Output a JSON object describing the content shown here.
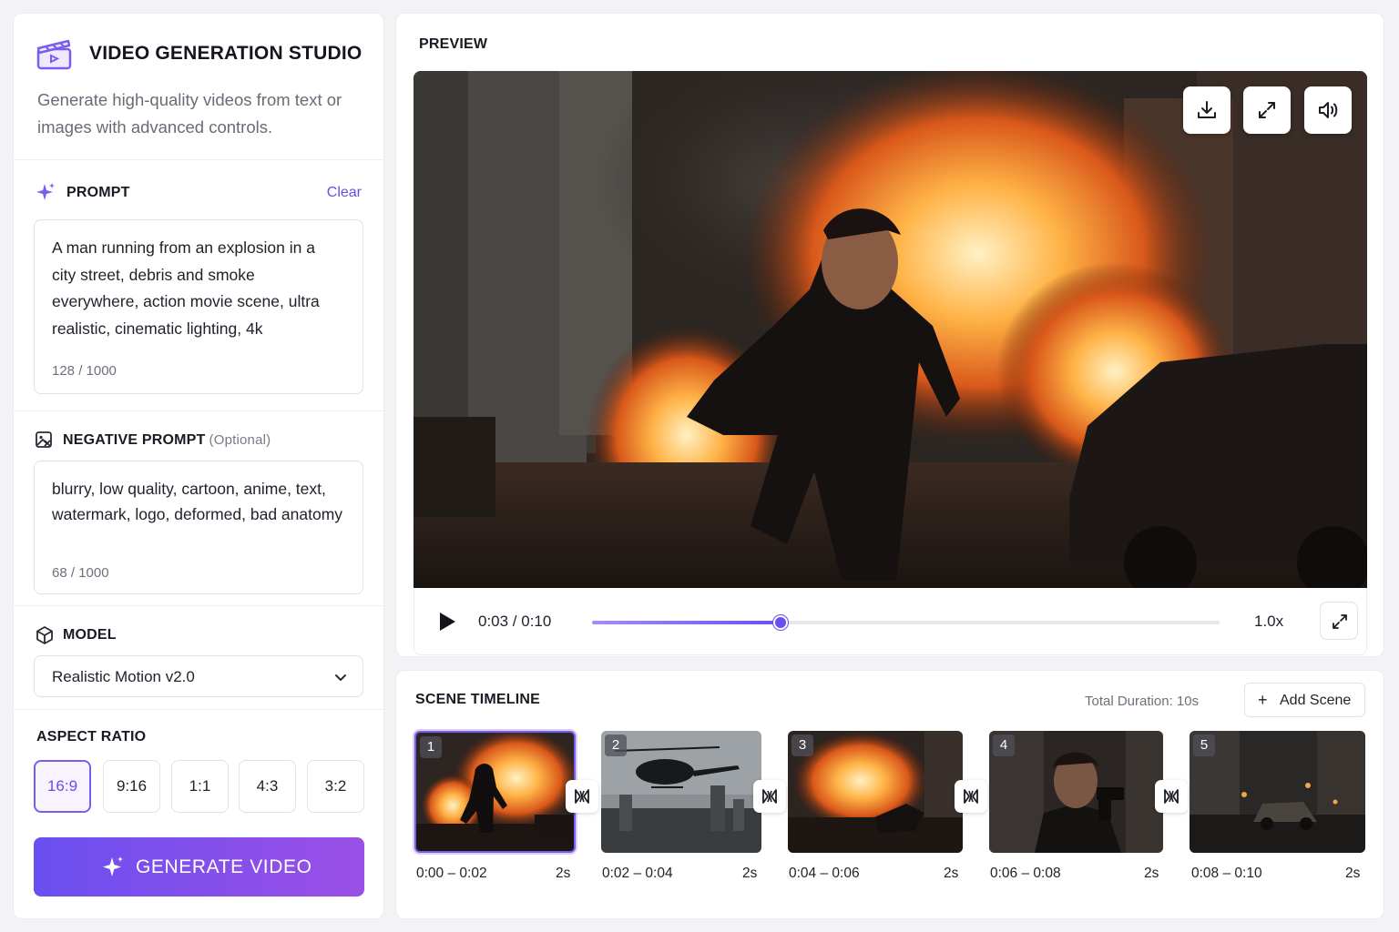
{
  "app": {
    "title": "VIDEO GENERATION STUDIO",
    "subtitle": "Generate high-quality videos from text or images with advanced controls."
  },
  "prompt": {
    "label": "PROMPT",
    "clear_label": "Clear",
    "text": "A man running from an explosion in a city street, debris and smoke everywhere, action movie scene, ultra realistic, cinematic lighting, 4k",
    "count": "128 / 1000"
  },
  "negative_prompt": {
    "label": "NEGATIVE PROMPT",
    "optional": "(Optional)",
    "text": "blurry, low quality, cartoon, anime, text, watermark, logo, deformed, bad anatomy",
    "count": "68 / 1000"
  },
  "model": {
    "label": "MODEL",
    "selected": "Realistic Motion v2.0"
  },
  "aspect_ratio": {
    "label": "ASPECT RATIO",
    "options": [
      "16:9",
      "9:16",
      "1:1",
      "4:3",
      "3:2"
    ],
    "selected": "16:9"
  },
  "generate_label": "GENERATE VIDEO",
  "preview": {
    "label": "PREVIEW",
    "time": "0:03 / 0:10",
    "progress": 0.3,
    "speed": "1.0x",
    "overlay_icons": [
      "download-icon",
      "expand-icon",
      "volume-icon"
    ]
  },
  "timeline": {
    "label": "SCENE TIMELINE",
    "total": "Total Duration: 10s",
    "add_label": "Add Scene",
    "scenes": [
      {
        "num": "1",
        "range": "0:00 – 0:02",
        "dur": "2s"
      },
      {
        "num": "2",
        "range": "0:02 – 0:04",
        "dur": "2s"
      },
      {
        "num": "3",
        "range": "0:04 – 0:06",
        "dur": "2s"
      },
      {
        "num": "4",
        "range": "0:06 – 0:08",
        "dur": "2s"
      },
      {
        "num": "5",
        "range": "0:08 – 0:10",
        "dur": "2s"
      }
    ]
  },
  "colors": {
    "accent": "#6b4ce6",
    "gradient_start": "#6a4ff0",
    "gradient_end": "#9b4fe6"
  }
}
